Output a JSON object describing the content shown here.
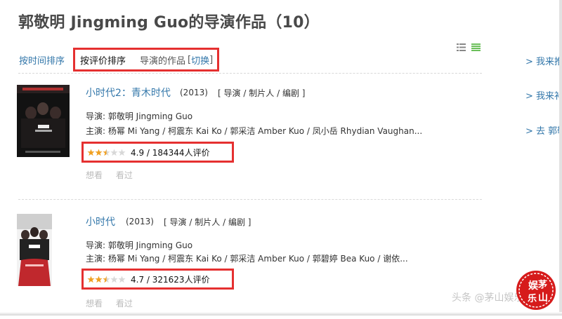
{
  "page": {
    "title": "郭敬明 Jingming Guo的导演作品（10）",
    "watermark": "头条 @茅山娱乐",
    "seal_text": "娱茅乐山"
  },
  "sort": {
    "by_time": "按时间排序",
    "by_rating": "按评价排序",
    "works_label": "导演的作品",
    "bracket_open": "[",
    "switch": "切换",
    "bracket_close": "]"
  },
  "view": {
    "icons": [
      "list-view-icon",
      "grid-view-icon"
    ]
  },
  "sidebar": {
    "links": [
      "> 我来推",
      "> 我来补",
      "> 去 郭敬"
    ]
  },
  "films": [
    {
      "title": "小时代2：青木时代",
      "year": "(2013)",
      "roles_open": "[",
      "roles": [
        "导演",
        "制片人",
        "编剧"
      ],
      "roles_sep": "/",
      "roles_close": "]",
      "director": "导演: 郭敬明 Jingming Guo",
      "cast": "主演: 杨幂 Mi Yang / 柯震东 Kai Ko / 郭采洁 Amber Kuo / 凤小岳 Rhydian Vaughan...",
      "stars": 2.5,
      "rating": "4.9 / 184344人评价",
      "actions": [
        "想看",
        "看过"
      ]
    },
    {
      "title": "小时代",
      "year": "(2013)",
      "roles_open": "[",
      "roles": [
        "导演",
        "制片人",
        "编剧"
      ],
      "roles_sep": "/",
      "roles_close": "]",
      "director": "导演: 郭敬明 Jingming Guo",
      "cast": "主演: 杨幂 Mi Yang / 柯震东 Kai Ko / 郭采洁 Amber Kuo / 郭碧婷 Bea Kuo / 谢依...",
      "stars": 2.5,
      "rating": "4.7 / 321623人评价",
      "actions": [
        "想看",
        "看过"
      ]
    }
  ],
  "colors": {
    "link": "#3377aa",
    "highlight_box": "#e53030",
    "star_on": "#f0a020",
    "star_off": "#d8d8d8",
    "seal": "#d61b1b"
  }
}
